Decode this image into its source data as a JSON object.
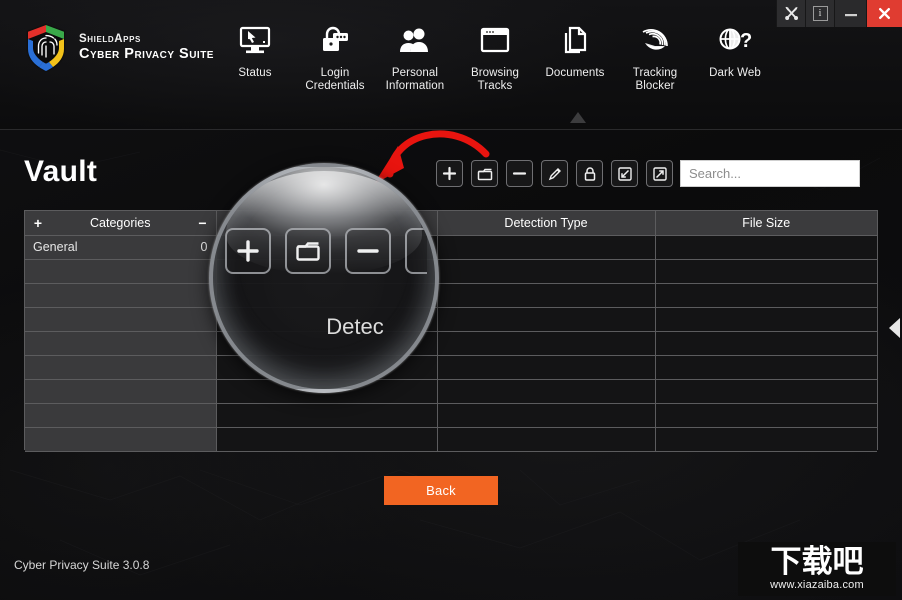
{
  "window": {
    "controls": [
      {
        "name": "tools-button",
        "icon": "tools-icon",
        "label": ""
      },
      {
        "name": "info-button",
        "icon": "info-icon",
        "label": "i"
      },
      {
        "name": "minimize-button",
        "icon": "minimize-icon",
        "label": ""
      },
      {
        "name": "close-button",
        "icon": "close-icon",
        "label": "✖"
      }
    ],
    "close_color": "#e03c31"
  },
  "brand": {
    "line1": "ShieldApps",
    "line2": "Cyber Privacy Suite",
    "logo": "shield-fingerprint-logo",
    "logo_colors": [
      "#e2302a",
      "#3aa94a",
      "#2a6fd6",
      "#f2c21a"
    ]
  },
  "nav": {
    "items": [
      {
        "id": "status",
        "label": "Status",
        "icon": "monitor-icon"
      },
      {
        "id": "login-credentials",
        "label": "Login\nCredentials",
        "label_line1": "Login",
        "label_line2": "Credentials",
        "icon": "padlock-password-icon"
      },
      {
        "id": "personal-information",
        "label_line1": "Personal",
        "label_line2": "Information",
        "icon": "users-icon"
      },
      {
        "id": "browsing-tracks",
        "label_line1": "Browsing",
        "label_line2": "Tracks",
        "icon": "browser-window-icon"
      },
      {
        "id": "documents",
        "label_line1": "Documents",
        "label_line2": "",
        "icon": "documents-icon"
      },
      {
        "id": "tracking-blocker",
        "label_line1": "Tracking",
        "label_line2": "Blocker",
        "icon": "radar-icon"
      },
      {
        "id": "dark-web",
        "label_line1": "Dark Web",
        "label_line2": "",
        "icon": "globe-question-icon"
      }
    ]
  },
  "main": {
    "page_title": "Vault",
    "actions": [
      {
        "id": "add",
        "icon": "plus-icon",
        "tooltip": "Add"
      },
      {
        "id": "folder",
        "icon": "folder-icon",
        "tooltip": "Folder"
      },
      {
        "id": "remove",
        "icon": "minus-icon",
        "tooltip": "Remove"
      },
      {
        "id": "edit",
        "icon": "pencil-icon",
        "tooltip": "Edit"
      },
      {
        "id": "lock",
        "icon": "lock-icon",
        "tooltip": "Lock"
      },
      {
        "id": "import",
        "icon": "import-arrow-icon",
        "tooltip": "Import"
      },
      {
        "id": "export",
        "icon": "export-arrow-icon",
        "tooltip": "Export"
      }
    ],
    "search": {
      "value": "",
      "placeholder": "Search..."
    },
    "back_label": "Back",
    "back_color": "#f26522"
  },
  "table": {
    "category_header": {
      "add": "+",
      "title": "Categories",
      "remove": "−"
    },
    "headers": [
      "Categories",
      "",
      "Detection Type",
      "File Size"
    ],
    "rows": [
      {
        "category": "General",
        "count": "0",
        "col2": "",
        "detection_type": "",
        "file_size": ""
      },
      {
        "category": "",
        "count": "",
        "col2": "",
        "detection_type": "",
        "file_size": ""
      },
      {
        "category": "",
        "count": "",
        "col2": "",
        "detection_type": "",
        "file_size": ""
      },
      {
        "category": "",
        "count": "",
        "col2": "",
        "detection_type": "",
        "file_size": ""
      },
      {
        "category": "",
        "count": "",
        "col2": "",
        "detection_type": "",
        "file_size": ""
      },
      {
        "category": "",
        "count": "",
        "col2": "",
        "detection_type": "",
        "file_size": ""
      },
      {
        "category": "",
        "count": "",
        "col2": "",
        "detection_type": "",
        "file_size": ""
      },
      {
        "category": "",
        "count": "",
        "col2": "",
        "detection_type": "",
        "file_size": ""
      },
      {
        "category": "",
        "count": "",
        "col2": "",
        "detection_type": "",
        "file_size": ""
      }
    ]
  },
  "magnifier": {
    "magnified_buttons": [
      "+",
      "folder",
      "−"
    ],
    "magnified_text": "Detec"
  },
  "footer": {
    "version": "Cyber Privacy Suite 3.0.8",
    "watermark_cjk": "下载吧",
    "watermark_url": "www.xiazaiba.com"
  },
  "side_toggle": {
    "icon": "chevron-left-icon"
  }
}
